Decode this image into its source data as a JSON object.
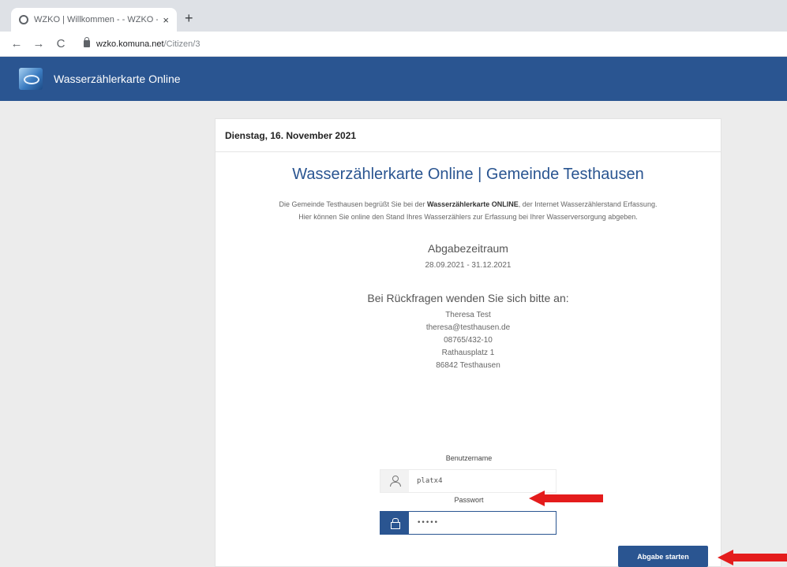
{
  "browser": {
    "tab_title": "WZKO | Willkommen - - WZKO -",
    "tab_close": "×",
    "new_tab": "+",
    "back": "←",
    "forward": "→",
    "reload": "C",
    "url_host": "wzko.komuna.net",
    "url_path": "/Citizen/3"
  },
  "appbar": {
    "title": "Wasserzählerkarte Online"
  },
  "card": {
    "date": "Dienstag, 16. November 2021",
    "title": "Wasserzählerkarte Online | Gemeinde Testhausen",
    "intro_part1": "Die Gemeinde Testhausen begrüßt Sie bei der ",
    "intro_bold": "Wasserzählerkarte ONLINE",
    "intro_part2": ", der Internet Wasserzählerstand Erfassung.",
    "intro_line2": "Hier können Sie online den Stand Ihres Wasserzählers zur Erfassung bei Ihrer Wasserversorgung abgeben.",
    "period_heading": "Abgabezeitraum",
    "period_range": "28.09.2021 - 31.12.2021",
    "contact_heading": "Bei Rückfragen wenden Sie sich bitte an:",
    "contact": [
      "Theresa Test",
      "theresa@testhausen.de",
      "08765/432-10",
      "Rathausplatz 1",
      "86842 Testhausen"
    ]
  },
  "form": {
    "username_label": "Benutzername",
    "username_value": "platx4",
    "password_label": "Passwort",
    "password_value": "•••••",
    "submit_label": "Abgabe starten"
  },
  "colors": {
    "brand": "#2a5591",
    "annotation_arrow": "#e41c1c"
  }
}
